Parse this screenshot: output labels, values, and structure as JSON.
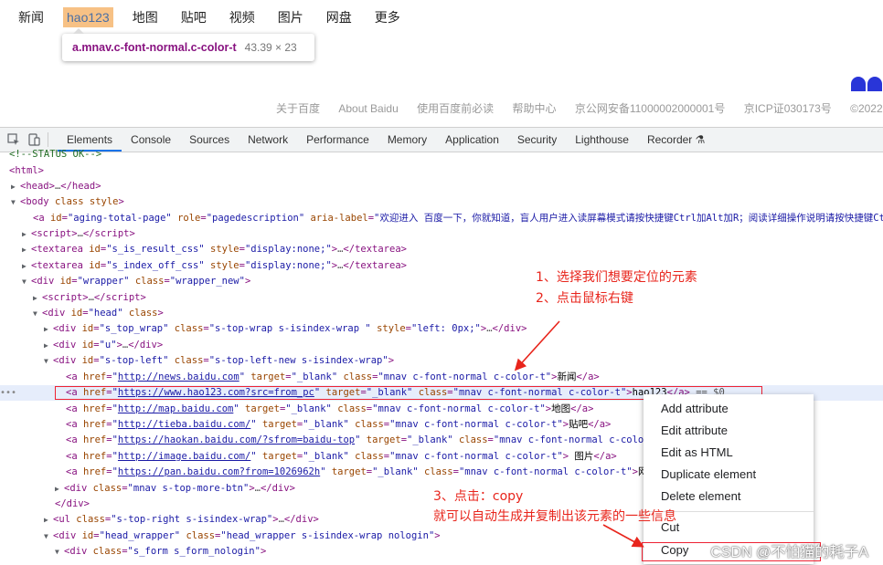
{
  "page": {
    "nav_links": [
      "新闻",
      "hao123",
      "地图",
      "贴吧",
      "视频",
      "图片",
      "网盘",
      "更多"
    ],
    "highlighted_index": 1,
    "tooltip": {
      "selector": "a.mnav.c-font-normal.c-color-t",
      "size": "43.39 × 23"
    },
    "footer_links": [
      "关于百度",
      "About Baidu",
      "使用百度前必读",
      "帮助中心",
      "京公网安备11000002000001号",
      "京ICP证030173号",
      "©2022"
    ]
  },
  "devtools": {
    "tabs": [
      "Elements",
      "Console",
      "Sources",
      "Network",
      "Performance",
      "Memory",
      "Application",
      "Security",
      "Lighthouse",
      "Recorder"
    ],
    "active_tab": "Elements",
    "dom": {
      "status_comment": "<!--STATUS OK-->",
      "aging_aria_label": "欢迎进入 百度一下，你就知道，盲人用户进入读屏幕模式请按快捷键Ctrl加Alt加R；阅读详细操作说明请按快捷键Ctrl加Alt加问号键。",
      "s_top_wrap_style": "left: 0px;",
      "links": [
        {
          "href": "http://news.baidu.com",
          "class": "mnav c-font-normal c-color-t",
          "text": "新闻"
        },
        {
          "href": "https://www.hao123.com?src=from_pc",
          "class": "mnav c-font-normal c-color-t",
          "text": "hao123",
          "suffix": "== $0"
        },
        {
          "href": "http://map.baidu.com",
          "class": "mnav c-font-normal c-color-t",
          "text": "地图"
        },
        {
          "href": "http://tieba.baidu.com/",
          "class": "mnav c-font-normal c-color-t",
          "text": "贴吧"
        },
        {
          "href": "https://haokan.baidu.com/?sfrom=baidu-top",
          "class": "mnav c-font-normal c-color-t",
          "text": "视频"
        },
        {
          "href": "http://image.baidu.com/",
          "class": "mnav c-font-normal c-color-t",
          "text": "图片"
        },
        {
          "href": "https://pan.baidu.com?from=1026962h",
          "class": "mnav c-font-normal c-color-t",
          "text": "网盘"
        }
      ]
    },
    "context_menu": [
      "Add attribute",
      "Edit attribute",
      "Edit as HTML",
      "Duplicate element",
      "Delete element",
      "Cut",
      "Copy"
    ]
  },
  "annotations": {
    "step1": "1、选择我们想要定位的元素",
    "step2": "2、点击鼠标右键",
    "step3": "3、点击：copy",
    "step3b": "就可以自动生成并复制出该元素的一些信息",
    "watermark": "CSDN @不怕猫的耗子A"
  },
  "colors": {
    "accent": "#1a73e8",
    "annotation_red": "#e8251c",
    "highlight": "#f7c185",
    "selection": "#e6edfb"
  }
}
